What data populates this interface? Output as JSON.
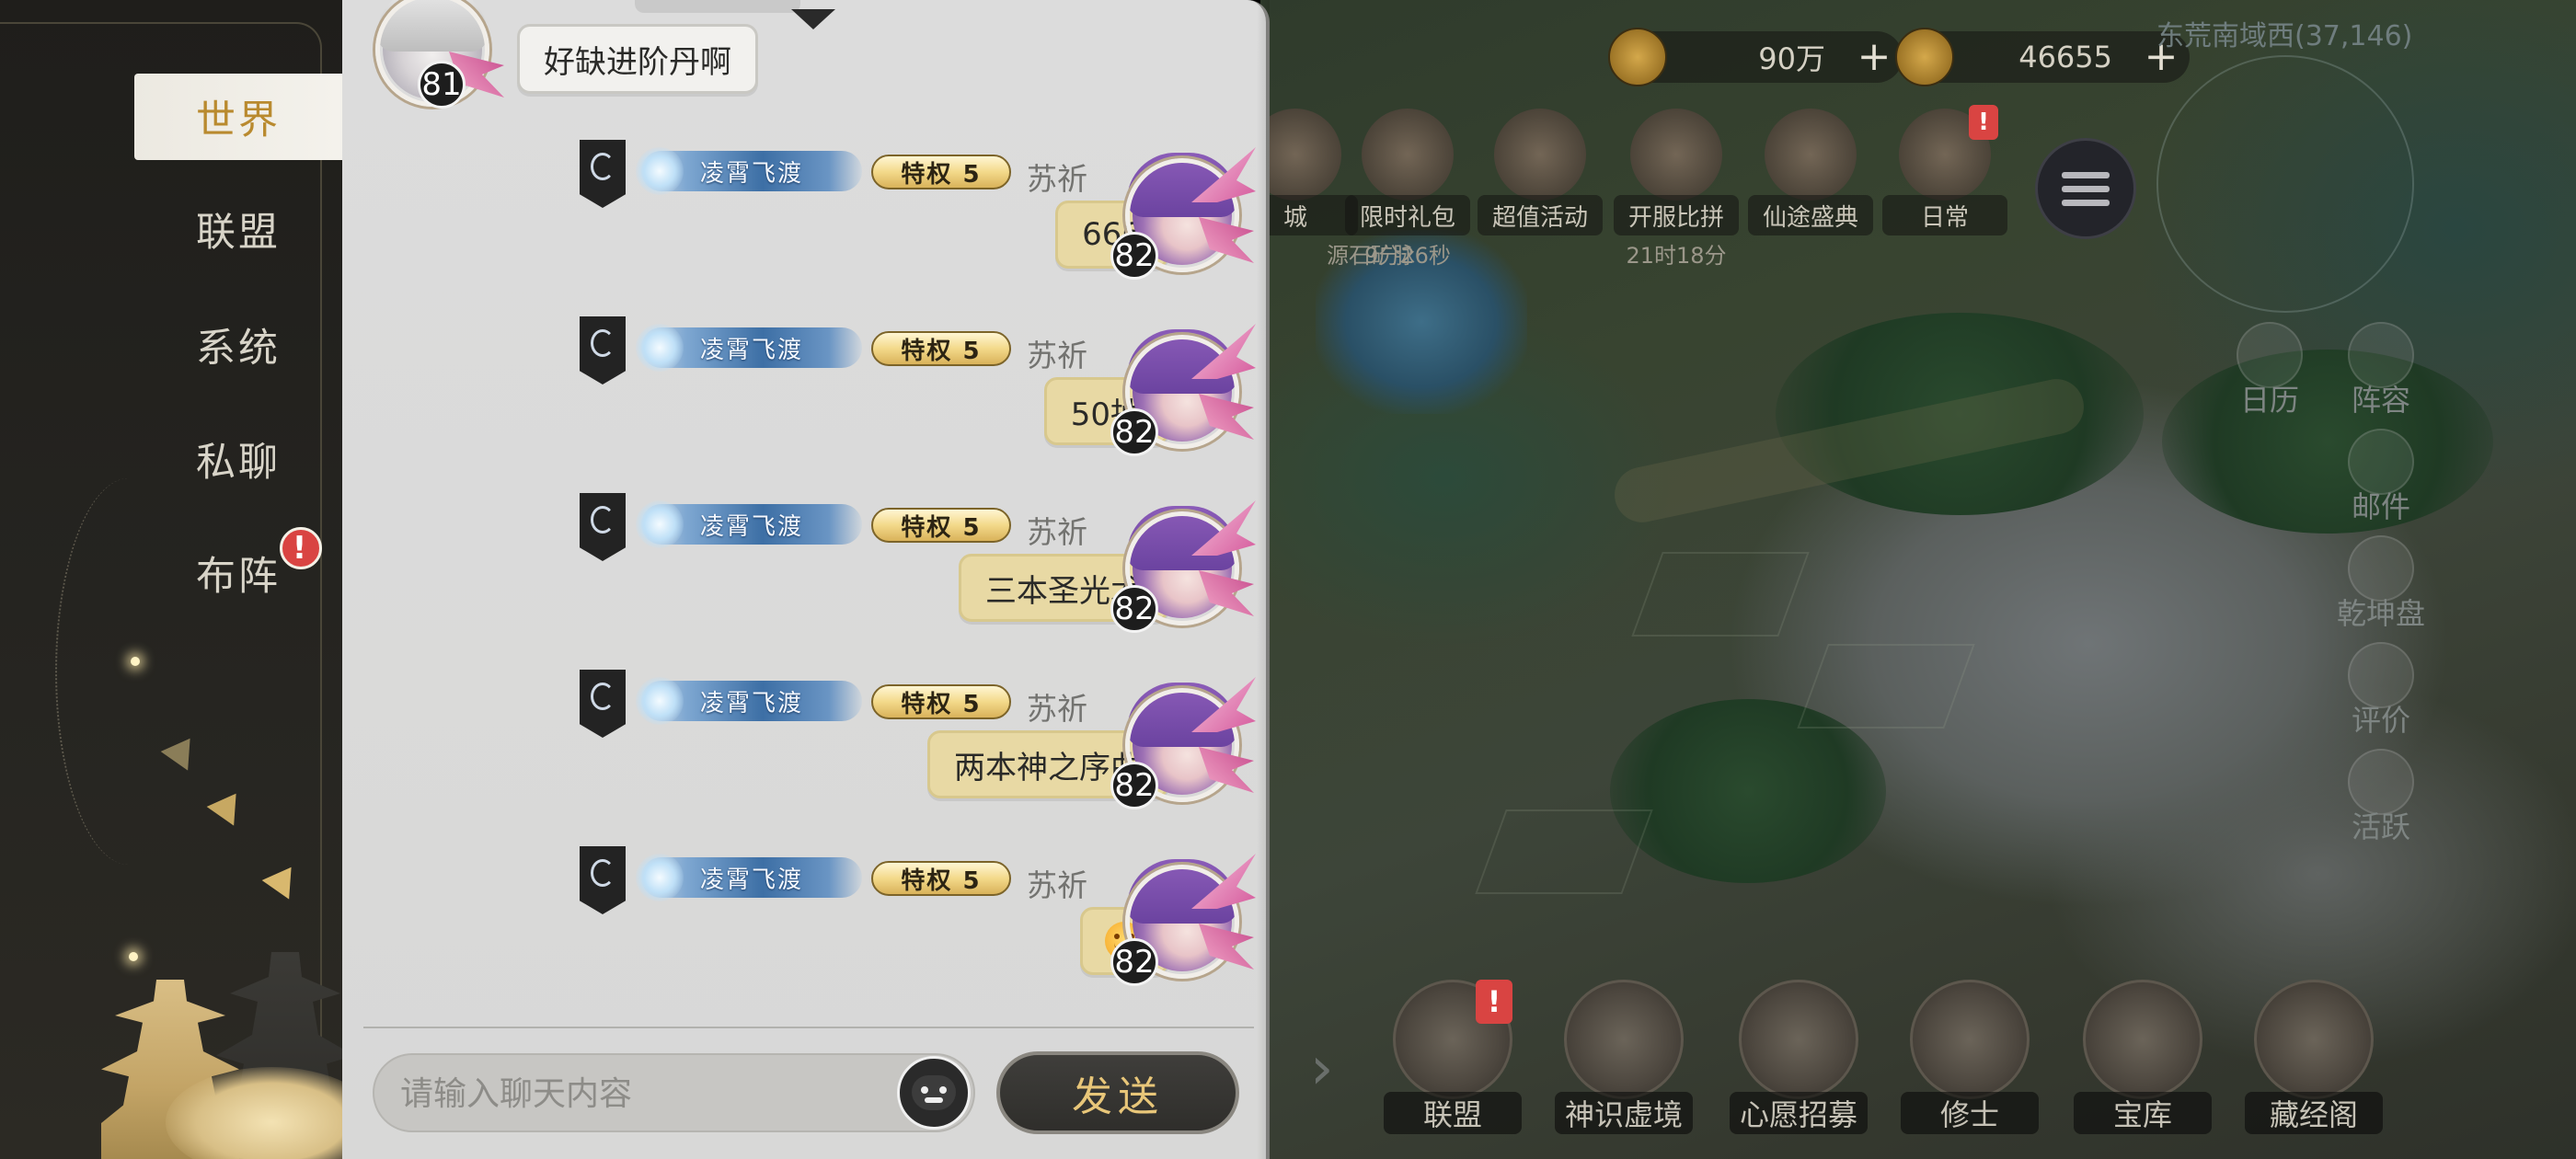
{
  "sidebar": {
    "tabs": [
      {
        "label": "世界",
        "active": true
      },
      {
        "label": "联盟",
        "active": false
      },
      {
        "label": "系统",
        "active": false
      },
      {
        "label": "私聊",
        "active": false
      },
      {
        "label": "布阵",
        "active": false,
        "badge": "!"
      }
    ]
  },
  "chat": {
    "top_message": {
      "level": "81",
      "text": "好缺进阶丹啊"
    },
    "messages": [
      {
        "title": "凌霄飞渡",
        "vip": "特权 5",
        "name": "苏祈",
        "level": "82",
        "text": "666"
      },
      {
        "title": "凌霄飞渡",
        "vip": "特权 5",
        "name": "苏祈",
        "level": "82",
        "text": "50抽"
      },
      {
        "title": "凌霄飞渡",
        "vip": "特权 5",
        "name": "苏祈",
        "level": "82",
        "text": "三本圣光术"
      },
      {
        "title": "凌霄飞渡",
        "vip": "特权 5",
        "name": "苏祈",
        "level": "82",
        "text": "两本神之序曲"
      },
      {
        "title": "凌霄飞渡",
        "vip": "特权 5",
        "name": "苏祈",
        "level": "82",
        "text": "",
        "emoji": "smile-emoji"
      }
    ],
    "input_placeholder": "请输入聊天内容",
    "send_label": "发送"
  },
  "hud": {
    "resource1": "90万",
    "resource2": "46655",
    "location": "东荒南域西(37,146)",
    "events": [
      {
        "label": "城",
        "sub": "源石矿脉"
      },
      {
        "label": "限时礼包",
        "sub": "9分26秒"
      },
      {
        "label": "超值活动",
        "sub": ""
      },
      {
        "label": "开服比拼",
        "sub": "21时18分"
      },
      {
        "label": "仙途盛典",
        "sub": ""
      },
      {
        "label": "日常",
        "sub": "",
        "badge": "!"
      }
    ],
    "side": [
      "日历",
      "阵容",
      "邮件",
      "乾坤盘",
      "评价",
      "活跃"
    ],
    "bottom": [
      {
        "label": "联盟",
        "badge": "!"
      },
      {
        "label": "神识虚境"
      },
      {
        "label": "心愿招募"
      },
      {
        "label": "修士"
      },
      {
        "label": "宝库"
      },
      {
        "label": "藏经阁"
      }
    ]
  },
  "colors": {
    "accent_gold": "#b98a2f",
    "bubble": "#e8d9a4",
    "badge_red": "#d94442",
    "send_text": "#e8c679"
  }
}
